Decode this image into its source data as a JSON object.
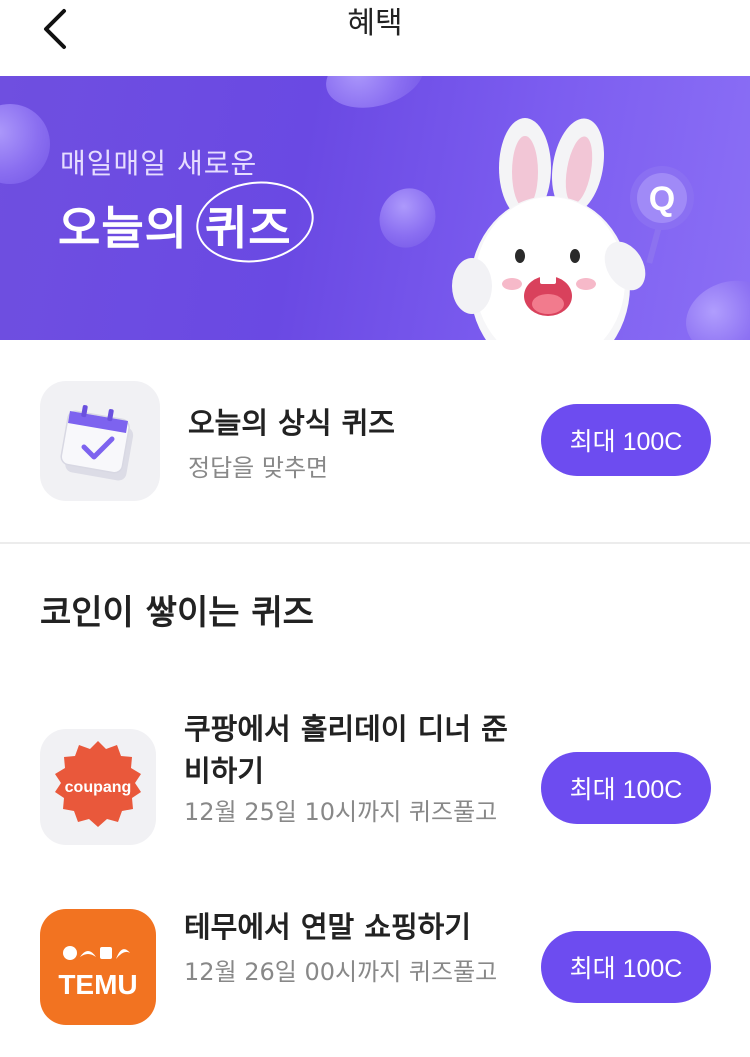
{
  "header": {
    "title": "혜택",
    "back_icon": "chevron-left-icon"
  },
  "banner": {
    "subtitle": "매일매일 새로운",
    "title": "오늘의 퀴즈",
    "badge_letter": "Q",
    "colors": {
      "background": "#6a49e3",
      "accent": "#6d4cf0"
    }
  },
  "daily_quiz": {
    "title": "오늘의 상식 퀴즈",
    "subtitle": "정답을 맞추면",
    "reward_label": "최대 100C",
    "icon": "calendar-check-icon"
  },
  "section": {
    "title": "코인이 쌓이는 퀴즈"
  },
  "quizzes": [
    {
      "brand": "coupang",
      "title": "쿠팡에서 홀리데이 디너 준비하기",
      "subtitle": "12월 25일 10시까지 퀴즈풀고",
      "reward_label": "최대 100C"
    },
    {
      "brand": "TEMU",
      "title": "테무에서 연말 쇼핑하기",
      "subtitle": "12월 26일 00시까지 퀴즈풀고",
      "reward_label": "최대 100C"
    }
  ]
}
